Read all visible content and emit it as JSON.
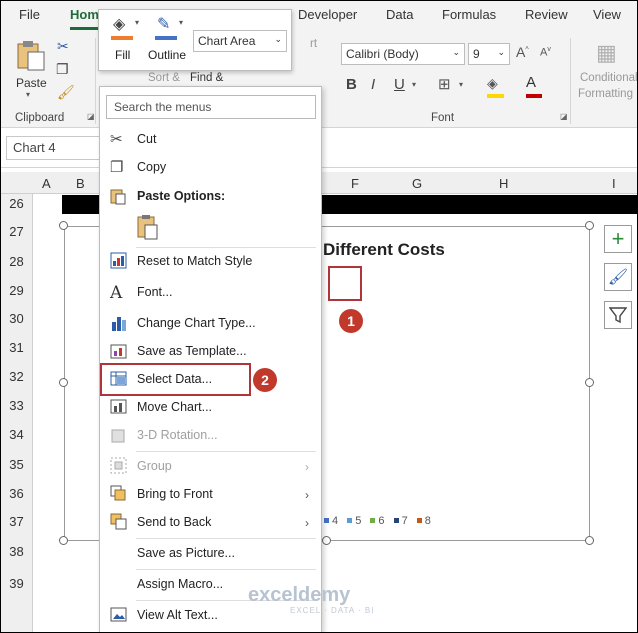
{
  "tabs": {
    "file": "File",
    "home": "Home",
    "developer": "Developer",
    "data": "Data",
    "formulas": "Formulas",
    "review": "Review",
    "view": "View"
  },
  "ribbon": {
    "paste": "Paste",
    "clipboard": "Clipboard",
    "sort": "Sort &",
    "find": "Find &",
    "font_name": "Calibri (Body)",
    "font_size": "9",
    "font_group": "Font",
    "conditional": "Conditional",
    "formatting": "Formatting",
    "font_color": "#c00000",
    "highlight_color": "#ffd700"
  },
  "namebox": {
    "value": "Chart 4"
  },
  "columns": [
    "A",
    "B",
    "F",
    "G",
    "H",
    "I"
  ],
  "rows": [
    "26",
    "27",
    "28",
    "29",
    "30",
    "31",
    "32",
    "33",
    "34",
    "35",
    "36",
    "37",
    "38",
    "39"
  ],
  "chart": {
    "title_fragment": "Different Costs",
    "legend": [
      {
        "label": "4",
        "color": "#4472c4"
      },
      {
        "label": "5",
        "color": "#5b9bd5"
      },
      {
        "label": "6",
        "color": "#70ad47"
      },
      {
        "label": "7",
        "color": "#264478"
      },
      {
        "label": "8",
        "color": "#c55a11"
      }
    ]
  },
  "mini_toolbar": {
    "fill": "Fill",
    "outline": "Outline",
    "element": "Chart Area",
    "fill_color": "#ed7d31",
    "outline_color": "#4472c4"
  },
  "menu": {
    "search_placeholder": "Search the menus",
    "items": [
      {
        "label": "Cut",
        "icon": "scissors-icon"
      },
      {
        "label": "Copy",
        "icon": "copy-icon"
      },
      {
        "label": "Paste Options:",
        "icon": "paste-icon"
      },
      {
        "label": "Reset to Match Style",
        "icon": "reset-style-icon"
      },
      {
        "label": "Font...",
        "icon": "font-icon"
      },
      {
        "label": "Change Chart Type...",
        "icon": "chart-type-icon"
      },
      {
        "label": "Save as Template...",
        "icon": "template-icon"
      },
      {
        "label": "Select Data...",
        "icon": "select-data-icon"
      },
      {
        "label": "Move Chart...",
        "icon": "move-chart-icon"
      },
      {
        "label": "3-D Rotation...",
        "icon": "rotation-icon"
      },
      {
        "label": "Group",
        "icon": "group-icon"
      },
      {
        "label": "Bring to Front",
        "icon": "bring-front-icon"
      },
      {
        "label": "Send to Back",
        "icon": "send-back-icon"
      },
      {
        "label": "Save as Picture...",
        "icon": ""
      },
      {
        "label": "Assign Macro...",
        "icon": ""
      },
      {
        "label": "View Alt Text...",
        "icon": "alt-text-icon"
      }
    ]
  },
  "badges": {
    "one": "1",
    "two": "2"
  },
  "watermark": {
    "name": "exceldemy",
    "tagline": "EXCEL · DATA · BI"
  }
}
